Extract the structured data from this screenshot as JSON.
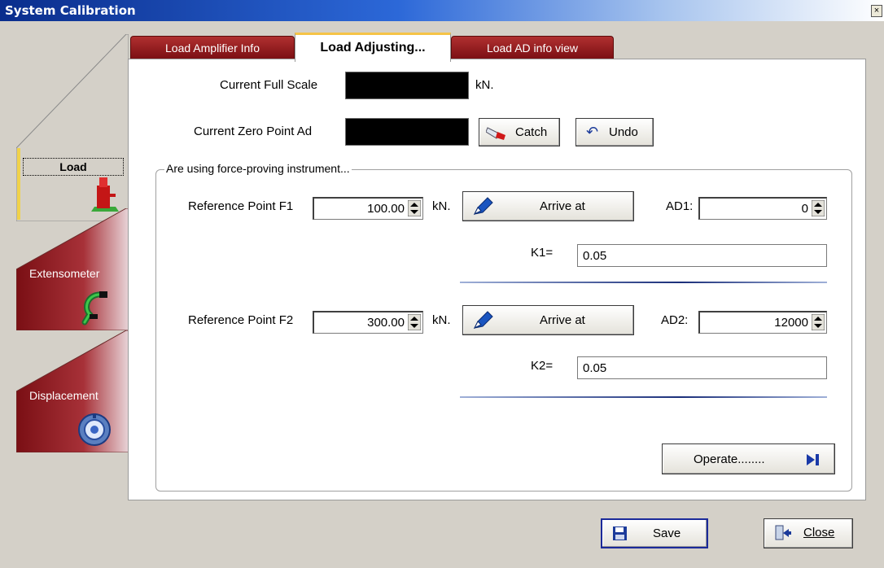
{
  "window": {
    "title": "System Calibration",
    "close": "×"
  },
  "side_tabs": [
    {
      "label": "Load"
    },
    {
      "label": "Extensometer"
    },
    {
      "label": "Displacement"
    }
  ],
  "tabs": [
    {
      "label": "Load Amplifier Info"
    },
    {
      "label": "Load Adjusting..."
    },
    {
      "label": "Load AD info view"
    }
  ],
  "load": {
    "full_scale_label": "Current Full Scale",
    "full_scale_unit": "kN.",
    "zero_point_label": "Current Zero Point Ad",
    "catch_label": "Catch",
    "undo_label": "Undo"
  },
  "group": {
    "caption": "Are using force-proving instrument...",
    "f1": {
      "label": "Reference Point F1",
      "value": "100.00",
      "unit": "kN.",
      "arrive": "Arrive at",
      "ad_label": "AD1:",
      "ad_value": "0",
      "k_label": "K1=",
      "k_value": "0.05"
    },
    "f2": {
      "label": "Reference Point F2",
      "value": "300.00",
      "unit": "kN.",
      "arrive": "Arrive at",
      "ad_label": "AD2:",
      "ad_value": "12000",
      "k_label": "K2=",
      "k_value": "0.05"
    },
    "operate_label": "Operate........"
  },
  "footer": {
    "save_label": "Save",
    "close_label": "Close"
  }
}
